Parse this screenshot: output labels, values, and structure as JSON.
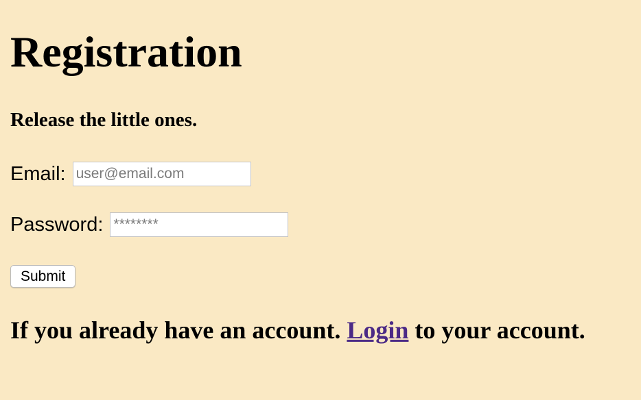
{
  "page": {
    "title": "Registration",
    "subtitle": "Release the little ones."
  },
  "form": {
    "email": {
      "label": "Email:",
      "value": "",
      "placeholder": "user@email.com"
    },
    "password": {
      "label": "Password:",
      "value": "",
      "placeholder": "********"
    },
    "submit_label": "Submit"
  },
  "footer": {
    "text_before": "If you already have an account.",
    "link_text": "Login",
    "text_after": "to your account."
  },
  "colors": {
    "background": "#fae9c4",
    "link": "#4b2a86"
  }
}
